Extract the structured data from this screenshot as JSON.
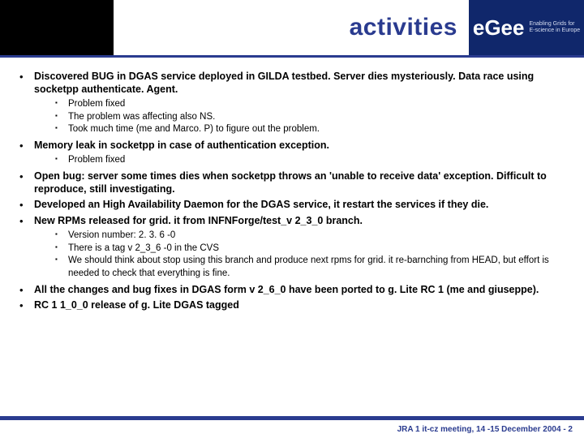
{
  "header": {
    "title": "activities",
    "logo_main": "eGee",
    "logo_sub_l1": "Enabling Grids for",
    "logo_sub_l2": "E-science in Europe"
  },
  "bullets": [
    {
      "text": "Discovered BUG in DGAS service deployed in GILDA testbed. Server dies mysteriously. Data race using socketpp authenticate. Agent.",
      "sub": [
        "Problem fixed",
        "The problem was affecting also NS.",
        "Took much time (me and Marco. P) to figure out the problem."
      ]
    },
    {
      "text": "Memory leak in socketpp in case of authentication exception.",
      "sub": [
        "Problem fixed"
      ]
    },
    {
      "text": "Open bug: server some times dies when socketpp throws an 'unable to receive data' exception. Difficult to reproduce, still investigating.",
      "sub": []
    },
    {
      "text": "Developed an High Availability Daemon for the DGAS service, it restart the services if they die.",
      "sub": []
    },
    {
      "text": "New RPMs released for grid. it from INFNForge/test_v 2_3_0 branch.",
      "sub": [
        "Version number: 2. 3. 6 -0",
        "There is a tag v 2_3_6 -0 in the CVS",
        "We should think about stop using this branch and produce next rpms for grid. it re-barnching from HEAD, but effort is needed to check that everything is fine."
      ]
    },
    {
      "text": "All the changes and bug fixes in DGAS form v 2_6_0 have been ported to g. Lite RC 1 (me and giuseppe).",
      "sub": []
    },
    {
      "text": "RC 1 1_0_0  release of g. Lite DGAS tagged",
      "sub": []
    }
  ],
  "footer": "JRA 1 it-cz meeting, 14 -15 December 2004 - 2"
}
